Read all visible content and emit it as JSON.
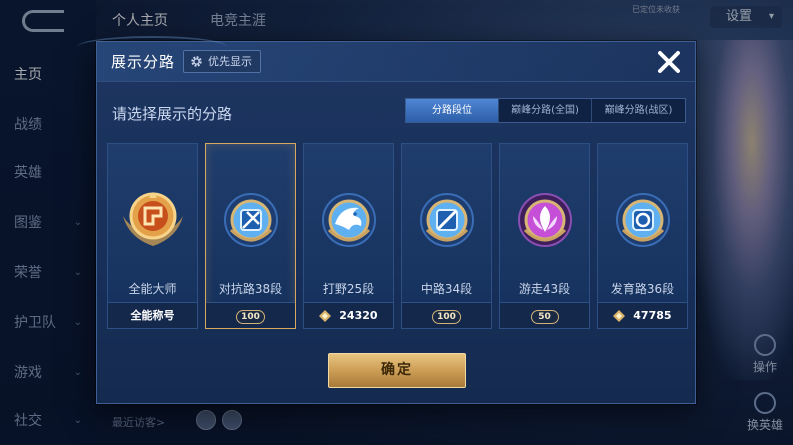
{
  "background": {
    "top_tabs": [
      "个人主页",
      "电竞主涯"
    ],
    "settings_label": "设置",
    "status_text": "已定位未收获",
    "sidebar_items": [
      {
        "label": "主页",
        "active": true,
        "chevron": false
      },
      {
        "label": "战绩",
        "active": false,
        "chevron": false
      },
      {
        "label": "英雄",
        "active": false,
        "chevron": false
      },
      {
        "label": "图鉴",
        "active": false,
        "chevron": true
      },
      {
        "label": "荣誉",
        "active": false,
        "chevron": true
      },
      {
        "label": "护卫队",
        "active": false,
        "chevron": true
      },
      {
        "label": "游戏",
        "active": false,
        "chevron": true
      },
      {
        "label": "社交",
        "active": false,
        "chevron": true
      }
    ],
    "visitors_label": "最近访客>",
    "right_buttons": [
      "操作",
      "换英雄"
    ]
  },
  "modal": {
    "title": "展示分路",
    "priority_label": "优先显示",
    "subtitle": "请选择展示的分路",
    "tabs": [
      {
        "label": "分路段位",
        "active": true
      },
      {
        "label": "巅峰分路(全国)",
        "active": false
      },
      {
        "label": "巅峰分路(战区)",
        "active": false
      }
    ],
    "cards": [
      {
        "label": "全能大师",
        "footer": "全能称号",
        "footer_type": "text",
        "badge": "all-round-master-badge",
        "color": "#d97a2b",
        "selected": false
      },
      {
        "label": "对抗路38段",
        "footer": "100",
        "footer_type": "star-pill",
        "badge": "clash-lane-badge",
        "color": "#3d8fe0",
        "selected": true
      },
      {
        "label": "打野25段",
        "footer": "24320",
        "footer_type": "points",
        "badge": "jungle-badge",
        "color": "#3d8fe0",
        "selected": false
      },
      {
        "label": "中路34段",
        "footer": "100",
        "footer_type": "star-pill",
        "badge": "mid-lane-badge",
        "color": "#3d8fe0",
        "selected": false
      },
      {
        "label": "游走43段",
        "footer": "50",
        "footer_type": "star-pill",
        "badge": "roam-badge",
        "color": "#b23cc7",
        "selected": false
      },
      {
        "label": "发育路36段",
        "footer": "47785",
        "footer_type": "points",
        "badge": "farm-lane-badge",
        "color": "#3d8fe0",
        "selected": false
      }
    ],
    "confirm_label": "确定"
  }
}
